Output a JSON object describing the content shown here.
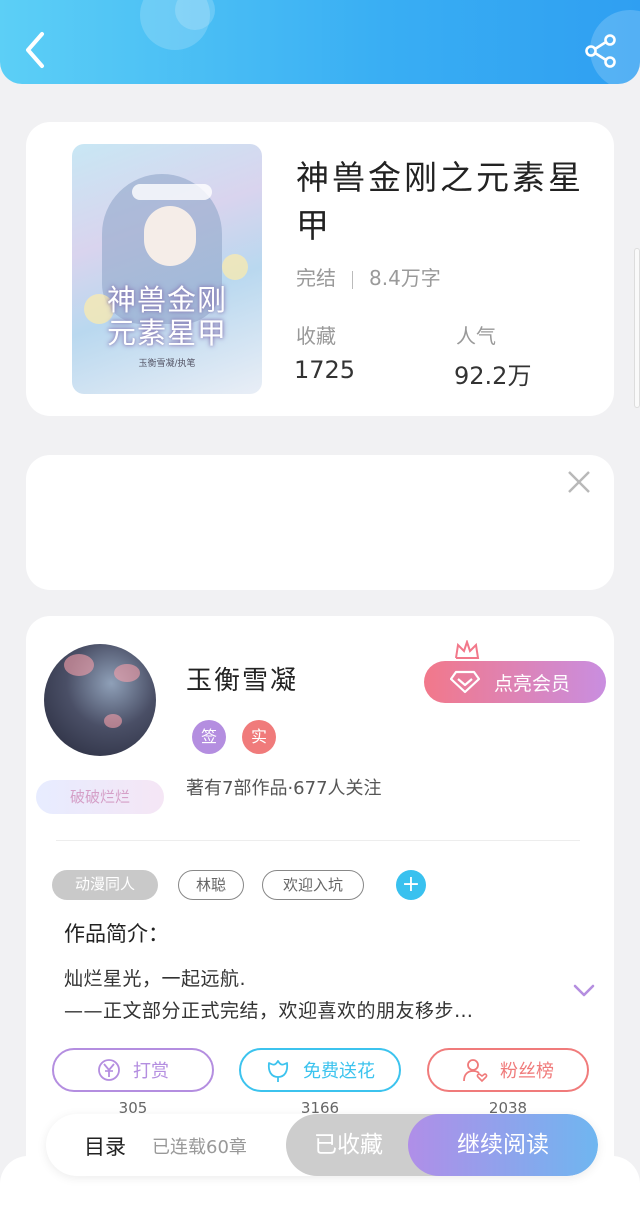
{
  "book": {
    "title": "神兽金刚之元素星甲",
    "status": "完结",
    "words": "8.4万字",
    "cover_title": "神兽金刚\n元素星甲",
    "cover_author": "玉衡雪凝/执笔",
    "collect_label": "收藏",
    "collect_value": "1725",
    "popularity_label": "人气",
    "popularity_value": "92.2万"
  },
  "author": {
    "name": "玉衡雪凝",
    "badge_text": "破破烂烂",
    "vip_label": "点亮会员",
    "sign_badge": "签",
    "real_badge": "实",
    "stats": "著有7部作品·677人关注"
  },
  "tags": [
    "动漫同人",
    "林聪",
    "欢迎入坑"
  ],
  "tag_add": "+",
  "intro": {
    "title": "作品简介：",
    "line1": "灿烂星光，一起远航.",
    "line2": "——正文部分正式完结，欢迎喜欢的朋友移步…"
  },
  "actions": [
    {
      "label": "打赏",
      "count": "305",
      "color": "#b48ee0"
    },
    {
      "label": "免费送花",
      "count": "3166",
      "color": "#3cc3ee"
    },
    {
      "label": "粉丝榜",
      "count": "2038",
      "color": "#f07b7b"
    }
  ],
  "bottom": {
    "toc_label": "目录",
    "toc_sub": "已连载60章",
    "collected_label": "已收藏",
    "read_label": "继续阅读"
  },
  "colors": {
    "header_blue": "#39aef3",
    "accent_pink": "#f2788a",
    "accent_purple": "#b48ee0",
    "accent_cyan": "#3cc3ee"
  }
}
